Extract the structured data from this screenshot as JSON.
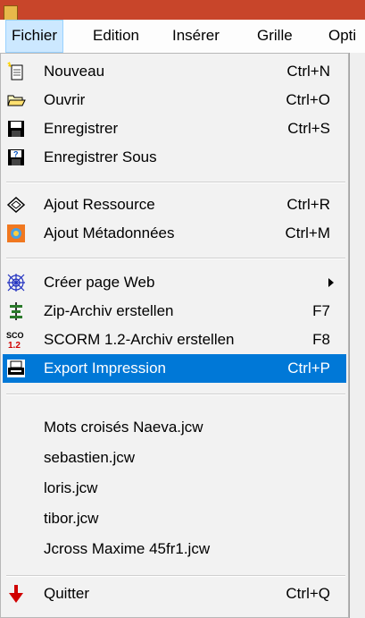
{
  "menubar": [
    "Fichier",
    "Edition",
    "Insérer",
    "Grille",
    "Opti"
  ],
  "menu": {
    "group1": [
      {
        "label": "Nouveau",
        "shortcut": "Ctrl+N",
        "icon": "new-document-icon"
      },
      {
        "label": "Ouvrir",
        "shortcut": "Ctrl+O",
        "icon": "open-folder-icon"
      },
      {
        "label": "Enregistrer",
        "shortcut": "Ctrl+S",
        "icon": "save-disk-icon"
      },
      {
        "label": "Enregistrer Sous",
        "shortcut": "",
        "icon": "save-as-icon"
      }
    ],
    "group2": [
      {
        "label": "Ajout Ressource",
        "shortcut": "Ctrl+R",
        "icon": "add-resource-icon"
      },
      {
        "label": "Ajout Métadonnées",
        "shortcut": "Ctrl+M",
        "icon": "add-metadata-icon"
      }
    ],
    "group3": [
      {
        "label": "Créer page Web",
        "shortcut": "",
        "icon": "web-icon",
        "submenu": true
      },
      {
        "label": "Zip-Archiv erstellen",
        "shortcut": "F7",
        "icon": "zip-icon"
      },
      {
        "label": "SCORM 1.2-Archiv erstellen",
        "shortcut": "F8",
        "icon": "scorm-icon",
        "icon_text_top": "SCO",
        "icon_text_bottom": "1.2"
      },
      {
        "label": "Export Impression",
        "shortcut": "Ctrl+P",
        "icon": "printer-icon",
        "highlighted": true
      }
    ],
    "recent_files": [
      "Mots croisés Naeva.jcw",
      "sebastien.jcw",
      "loris.jcw",
      "tibor.jcw",
      "Jcross Maxime 45fr1.jcw"
    ],
    "quit": {
      "label": "Quitter",
      "shortcut": "Ctrl+Q",
      "icon": "quit-arrow-icon"
    }
  },
  "colors": {
    "highlight": "#0078d7",
    "menu_bg": "#f2f2f2",
    "title_strip": "#c8452a"
  }
}
